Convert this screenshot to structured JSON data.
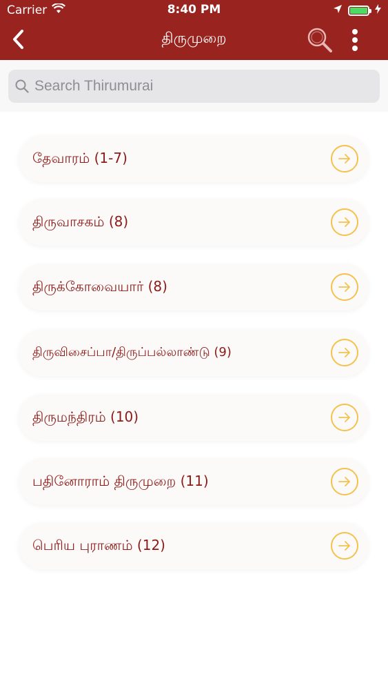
{
  "status_bar": {
    "carrier": "Carrier",
    "time": "8:40 PM"
  },
  "nav": {
    "title": "திருமுறை"
  },
  "search": {
    "placeholder": "Search Thirumurai"
  },
  "colors": {
    "header_bg": "#99231f",
    "item_text": "#8b1a17",
    "arrow_accent": "#f4c24c"
  },
  "items": [
    {
      "label": "தேவாரம் (1-7)"
    },
    {
      "label": "திருவாசகம் (8)"
    },
    {
      "label": "திருக்கோவையார் (8)"
    },
    {
      "label": "திருவிசைப்பா/திருப்பல்லாண்டு (9)"
    },
    {
      "label": "திருமந்திரம் (10)"
    },
    {
      "label": "பதினோராம் திருமுறை (11)"
    },
    {
      "label": "பெரிய புராணம் (12)"
    }
  ],
  "icons": {
    "back": "chevron-left-icon",
    "search": "search-icon",
    "more": "more-vertical-icon",
    "arrow": "arrow-right-circle-icon"
  }
}
